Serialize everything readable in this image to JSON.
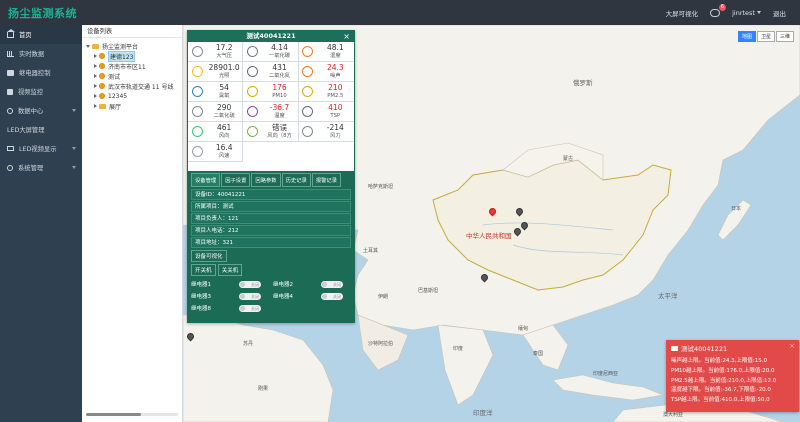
{
  "header": {
    "title": "扬尘监测系统",
    "big_screen": "大屏可视化",
    "notify_count": "6",
    "user": "jinrtest",
    "logout": "退出"
  },
  "sidebar": {
    "items": [
      {
        "label": "首页",
        "icon": "home-icon"
      },
      {
        "label": "实时数据",
        "icon": "bar-chart-icon"
      },
      {
        "label": "继电器控制",
        "icon": "plug-icon"
      },
      {
        "label": "视频监控",
        "icon": "video-icon"
      },
      {
        "label": "数据中心",
        "icon": "gear-icon"
      },
      {
        "label": "LED大屏管理",
        "icon": "text-icon"
      },
      {
        "label": "LED视频显示",
        "icon": "monitor-icon"
      },
      {
        "label": "系统管理",
        "icon": "cog-icon"
      }
    ]
  },
  "device_list": {
    "title": "设备列表",
    "root": "扬尘监测平台",
    "nodes": [
      "建德123",
      "济南市市区11",
      "测试",
      "武汉市轨道交通 11 号线",
      "12345",
      "展厅"
    ]
  },
  "map": {
    "types": [
      "地图",
      "卫星",
      "三维"
    ],
    "labels": [
      {
        "text": "俄罗斯",
        "cls": "big"
      },
      {
        "text": "蒙古",
        "cls": ""
      },
      {
        "text": "哈萨克斯坦",
        "cls": ""
      },
      {
        "text": "中华人民共和国",
        "cls": "red"
      },
      {
        "text": "太平洋",
        "cls": "big"
      },
      {
        "text": "印度",
        "cls": ""
      },
      {
        "text": "沙特阿拉伯",
        "cls": ""
      },
      {
        "text": "苏丹",
        "cls": ""
      },
      {
        "text": "刚果",
        "cls": ""
      },
      {
        "text": "澳大利亚",
        "cls": ""
      },
      {
        "text": "印度洋",
        "cls": "big"
      },
      {
        "text": "缅甸",
        "cls": ""
      },
      {
        "text": "泰国",
        "cls": ""
      },
      {
        "text": "巴基斯坦",
        "cls": ""
      },
      {
        "text": "伊朗",
        "cls": ""
      },
      {
        "text": "土耳其",
        "cls": ""
      },
      {
        "text": "印度尼西亚",
        "cls": ""
      },
      {
        "text": "日本",
        "cls": ""
      }
    ]
  },
  "popup": {
    "title": "测试40041221",
    "close": "×",
    "sensors": [
      {
        "value": "17.2",
        "name": "大气压",
        "warn": false,
        "icon": "pressure-icon"
      },
      {
        "value": "4.14",
        "name": "一氧化碳",
        "warn": false,
        "icon": "cloud-icon"
      },
      {
        "value": "48.1",
        "name": "湿度",
        "warn": false,
        "icon": "humidity-icon"
      },
      {
        "value": "28901.0",
        "name": "光照",
        "warn": false,
        "icon": "sun-icon"
      },
      {
        "value": "431",
        "name": "二氧化氮",
        "warn": false,
        "icon": "no2-icon"
      },
      {
        "value": "24.3",
        "name": "噪声",
        "warn": true,
        "icon": "speaker-icon"
      },
      {
        "value": "54",
        "name": "臭氧",
        "warn": false,
        "icon": "ozone-icon"
      },
      {
        "value": "176",
        "name": "PM10",
        "warn": true,
        "icon": "pm10-icon"
      },
      {
        "value": "210",
        "name": "PM2.5",
        "warn": true,
        "icon": "pm25-icon"
      },
      {
        "value": "290",
        "name": "二氧化硫",
        "warn": false,
        "icon": "so2-icon"
      },
      {
        "value": "-36.7",
        "name": "温度",
        "warn": true,
        "icon": "thermometer-icon"
      },
      {
        "value": "410",
        "name": "TSP",
        "warn": true,
        "icon": "tsp-icon"
      },
      {
        "value": "461",
        "name": "风向",
        "warn": false,
        "icon": "compass-icon"
      },
      {
        "value": "错误",
        "name": "风向（8方",
        "warn": false,
        "icon": "direction-icon"
      },
      {
        "value": "-214",
        "name": "风力",
        "warn": false,
        "icon": "wind-icon"
      },
      {
        "value": "16.4",
        "name": "风速",
        "warn": false,
        "icon": "wind-speed-icon"
      }
    ],
    "tabs": [
      "设备管理",
      "因子设置",
      "回路参数",
      "历史记录",
      "报警记录"
    ],
    "info": [
      "设备ID：40041221",
      "所属项目：测试",
      "项目负责人：121",
      "项目人电话：212",
      "项目地址：321"
    ],
    "visual_btn": "设备可视化",
    "switch_on": "开关机",
    "switch_off": "关关机",
    "relays": [
      {
        "label": "继电器1",
        "state": "关闭"
      },
      {
        "label": "继电器2",
        "state": "关闭"
      },
      {
        "label": "继电器3",
        "state": "关闭"
      },
      {
        "label": "继电器4",
        "state": "关闭"
      },
      {
        "label": "继电器8",
        "state": "关闭"
      }
    ]
  },
  "alert": {
    "title": "测试40041221",
    "close": "×",
    "lines": [
      "噪声越上限。当前值:24.3,上限值:15.0",
      "PM10越上限。当前值:176.0,上限值:20.0",
      "PM2.5越上限。当前值:210.0,上限值:12.0",
      "温度越下限。当前值:-36.7,下限值:-20.0",
      "TSP越上限。当前值:410.0,上限值:50.0"
    ]
  }
}
